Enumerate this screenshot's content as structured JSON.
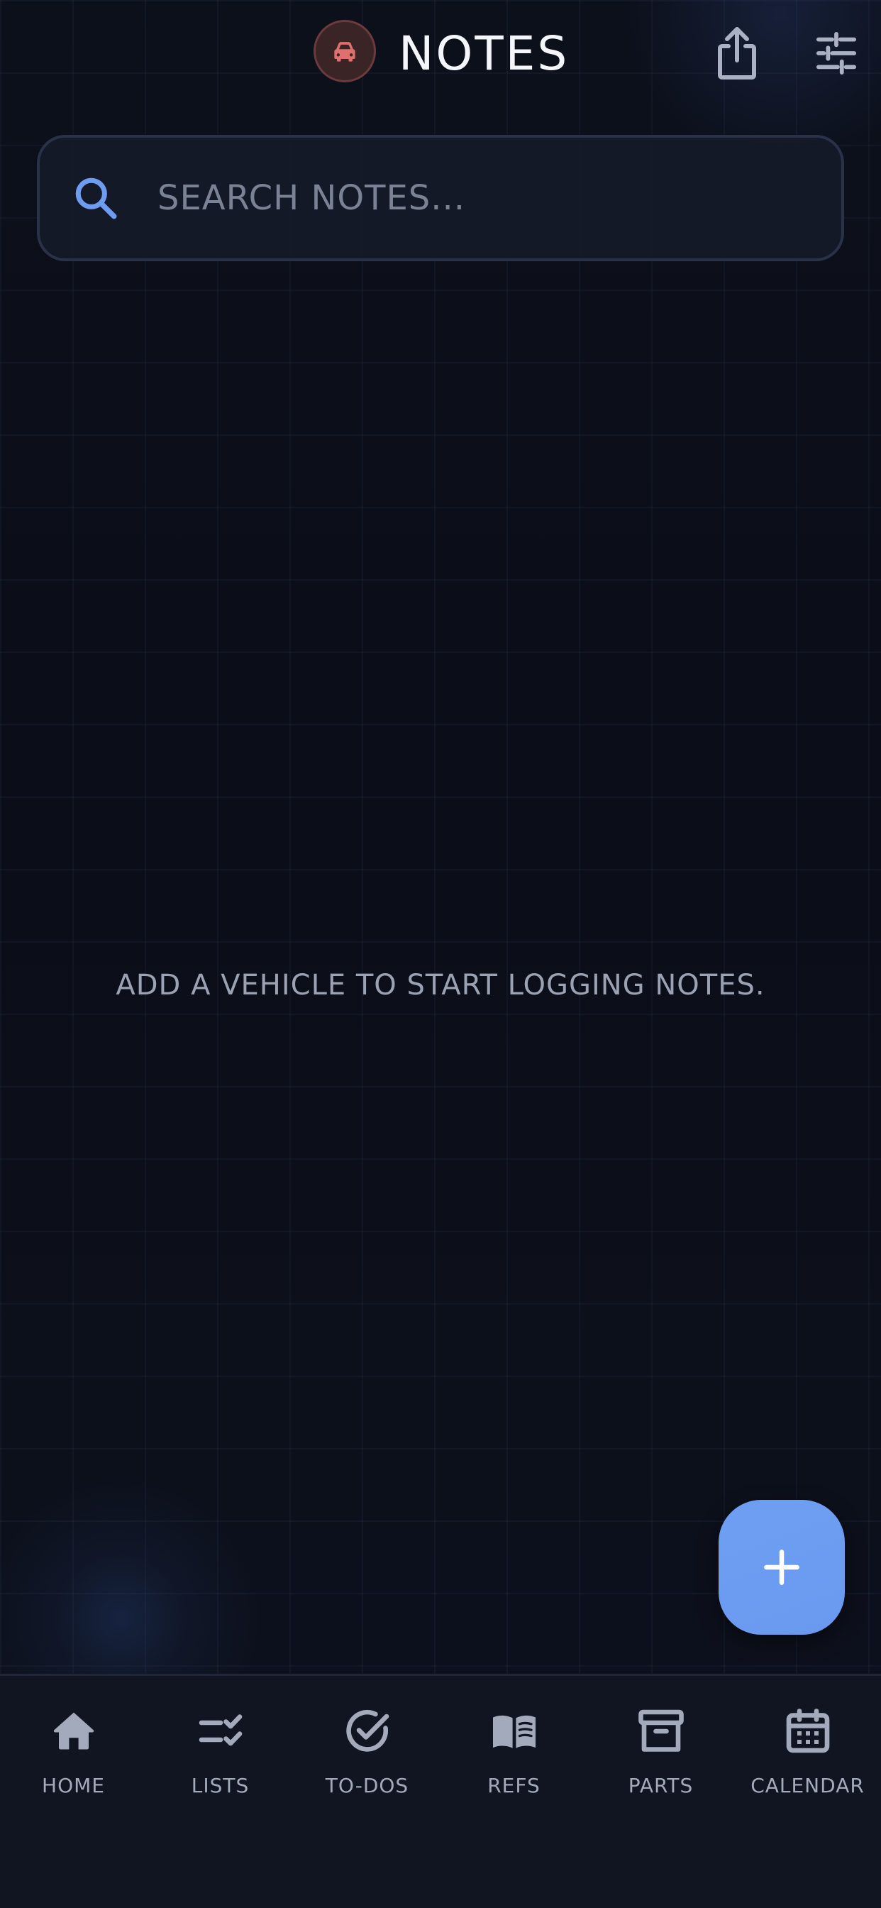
{
  "header": {
    "title": "NOTES",
    "vehicle_icon": "car-icon",
    "share_icon": "share-icon",
    "filter_icon": "sliders-icon"
  },
  "search": {
    "placeholder": "SEARCH NOTES...",
    "value": "",
    "icon": "search-icon"
  },
  "empty_state": {
    "message": "ADD A VEHICLE TO START LOGGING NOTES."
  },
  "fab": {
    "icon": "plus-icon"
  },
  "nav": {
    "items": [
      {
        "label": "HOME",
        "icon": "home-icon"
      },
      {
        "label": "LISTS",
        "icon": "checklist-icon"
      },
      {
        "label": "TO-DOS",
        "icon": "check-circle-icon"
      },
      {
        "label": "REFS",
        "icon": "book-icon"
      },
      {
        "label": "PARTS",
        "icon": "archive-box-icon"
      },
      {
        "label": "CALENDAR",
        "icon": "calendar-icon"
      }
    ]
  },
  "colors": {
    "background": "#0b0e16",
    "accent": "#6d9cf1",
    "vehicle_badge": "#e0706e",
    "nav_background": "#111522",
    "muted_text": "#9aa2b4"
  }
}
